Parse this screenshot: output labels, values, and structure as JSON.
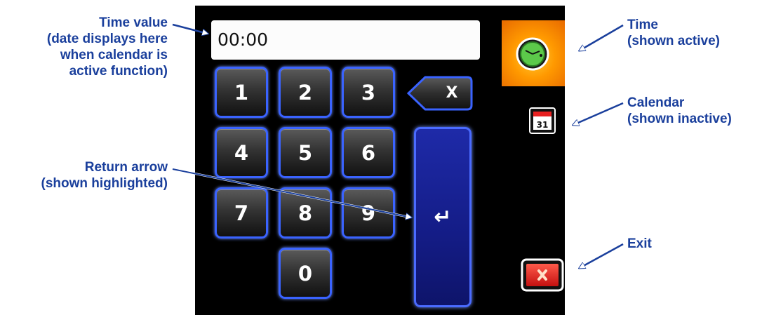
{
  "display": {
    "time_value": "00:00"
  },
  "keypad": {
    "keys": [
      "1",
      "2",
      "3",
      "4",
      "5",
      "6",
      "7",
      "8",
      "9",
      "0"
    ],
    "backspace_label": "X",
    "enter_symbol": "↵"
  },
  "modes": {
    "time_icon": "clock-icon",
    "calendar_icon": "calendar-icon",
    "calendar_day": "31",
    "exit_icon": "close-icon"
  },
  "callouts": {
    "time_value": [
      "Time value",
      "(date displays here",
      "when calendar is",
      "active function)"
    ],
    "return_arrow": [
      "Return arrow",
      "(shown highlighted)"
    ],
    "time": [
      "Time",
      "(shown active)"
    ],
    "calendar": [
      "Calendar",
      "(shown inactive)"
    ],
    "exit": [
      "Exit"
    ]
  },
  "colors": {
    "callout_text": "#1a3f9c",
    "key_border": "#3a63ff",
    "enter_fill": "#141c86",
    "time_tile": "#ff9900",
    "exit_fill": "#e81e1e"
  }
}
